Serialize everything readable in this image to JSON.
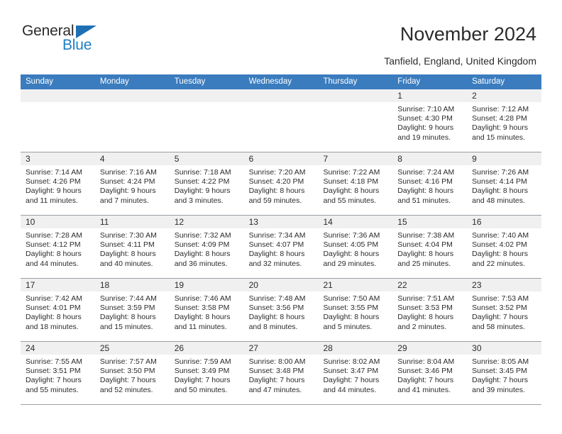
{
  "brand": {
    "name_part1": "General",
    "name_part2": "Blue",
    "triangle_color": "#1f6fb5",
    "blue_text_color": "#1f7fc4"
  },
  "header": {
    "title": "November 2024",
    "subtitle": "Tanfield, England, United Kingdom",
    "header_bg_color": "#3a7cbe",
    "day_band_color": "#f0f0f0"
  },
  "weekdays": [
    "Sunday",
    "Monday",
    "Tuesday",
    "Wednesday",
    "Thursday",
    "Friday",
    "Saturday"
  ],
  "weeks": [
    {
      "days": [
        {
          "date": "",
          "sunrise": "",
          "sunset": "",
          "daylight_line1": "",
          "daylight_line2": "",
          "empty": true
        },
        {
          "date": "",
          "sunrise": "",
          "sunset": "",
          "daylight_line1": "",
          "daylight_line2": "",
          "empty": true
        },
        {
          "date": "",
          "sunrise": "",
          "sunset": "",
          "daylight_line1": "",
          "daylight_line2": "",
          "empty": true
        },
        {
          "date": "",
          "sunrise": "",
          "sunset": "",
          "daylight_line1": "",
          "daylight_line2": "",
          "empty": true
        },
        {
          "date": "",
          "sunrise": "",
          "sunset": "",
          "daylight_line1": "",
          "daylight_line2": "",
          "empty": true
        },
        {
          "date": "1",
          "sunrise": "Sunrise: 7:10 AM",
          "sunset": "Sunset: 4:30 PM",
          "daylight_line1": "Daylight: 9 hours",
          "daylight_line2": "and 19 minutes.",
          "empty": false
        },
        {
          "date": "2",
          "sunrise": "Sunrise: 7:12 AM",
          "sunset": "Sunset: 4:28 PM",
          "daylight_line1": "Daylight: 9 hours",
          "daylight_line2": "and 15 minutes.",
          "empty": false
        }
      ]
    },
    {
      "days": [
        {
          "date": "3",
          "sunrise": "Sunrise: 7:14 AM",
          "sunset": "Sunset: 4:26 PM",
          "daylight_line1": "Daylight: 9 hours",
          "daylight_line2": "and 11 minutes.",
          "empty": false
        },
        {
          "date": "4",
          "sunrise": "Sunrise: 7:16 AM",
          "sunset": "Sunset: 4:24 PM",
          "daylight_line1": "Daylight: 9 hours",
          "daylight_line2": "and 7 minutes.",
          "empty": false
        },
        {
          "date": "5",
          "sunrise": "Sunrise: 7:18 AM",
          "sunset": "Sunset: 4:22 PM",
          "daylight_line1": "Daylight: 9 hours",
          "daylight_line2": "and 3 minutes.",
          "empty": false
        },
        {
          "date": "6",
          "sunrise": "Sunrise: 7:20 AM",
          "sunset": "Sunset: 4:20 PM",
          "daylight_line1": "Daylight: 8 hours",
          "daylight_line2": "and 59 minutes.",
          "empty": false
        },
        {
          "date": "7",
          "sunrise": "Sunrise: 7:22 AM",
          "sunset": "Sunset: 4:18 PM",
          "daylight_line1": "Daylight: 8 hours",
          "daylight_line2": "and 55 minutes.",
          "empty": false
        },
        {
          "date": "8",
          "sunrise": "Sunrise: 7:24 AM",
          "sunset": "Sunset: 4:16 PM",
          "daylight_line1": "Daylight: 8 hours",
          "daylight_line2": "and 51 minutes.",
          "empty": false
        },
        {
          "date": "9",
          "sunrise": "Sunrise: 7:26 AM",
          "sunset": "Sunset: 4:14 PM",
          "daylight_line1": "Daylight: 8 hours",
          "daylight_line2": "and 48 minutes.",
          "empty": false
        }
      ]
    },
    {
      "days": [
        {
          "date": "10",
          "sunrise": "Sunrise: 7:28 AM",
          "sunset": "Sunset: 4:12 PM",
          "daylight_line1": "Daylight: 8 hours",
          "daylight_line2": "and 44 minutes.",
          "empty": false
        },
        {
          "date": "11",
          "sunrise": "Sunrise: 7:30 AM",
          "sunset": "Sunset: 4:11 PM",
          "daylight_line1": "Daylight: 8 hours",
          "daylight_line2": "and 40 minutes.",
          "empty": false
        },
        {
          "date": "12",
          "sunrise": "Sunrise: 7:32 AM",
          "sunset": "Sunset: 4:09 PM",
          "daylight_line1": "Daylight: 8 hours",
          "daylight_line2": "and 36 minutes.",
          "empty": false
        },
        {
          "date": "13",
          "sunrise": "Sunrise: 7:34 AM",
          "sunset": "Sunset: 4:07 PM",
          "daylight_line1": "Daylight: 8 hours",
          "daylight_line2": "and 32 minutes.",
          "empty": false
        },
        {
          "date": "14",
          "sunrise": "Sunrise: 7:36 AM",
          "sunset": "Sunset: 4:05 PM",
          "daylight_line1": "Daylight: 8 hours",
          "daylight_line2": "and 29 minutes.",
          "empty": false
        },
        {
          "date": "15",
          "sunrise": "Sunrise: 7:38 AM",
          "sunset": "Sunset: 4:04 PM",
          "daylight_line1": "Daylight: 8 hours",
          "daylight_line2": "and 25 minutes.",
          "empty": false
        },
        {
          "date": "16",
          "sunrise": "Sunrise: 7:40 AM",
          "sunset": "Sunset: 4:02 PM",
          "daylight_line1": "Daylight: 8 hours",
          "daylight_line2": "and 22 minutes.",
          "empty": false
        }
      ]
    },
    {
      "days": [
        {
          "date": "17",
          "sunrise": "Sunrise: 7:42 AM",
          "sunset": "Sunset: 4:01 PM",
          "daylight_line1": "Daylight: 8 hours",
          "daylight_line2": "and 18 minutes.",
          "empty": false
        },
        {
          "date": "18",
          "sunrise": "Sunrise: 7:44 AM",
          "sunset": "Sunset: 3:59 PM",
          "daylight_line1": "Daylight: 8 hours",
          "daylight_line2": "and 15 minutes.",
          "empty": false
        },
        {
          "date": "19",
          "sunrise": "Sunrise: 7:46 AM",
          "sunset": "Sunset: 3:58 PM",
          "daylight_line1": "Daylight: 8 hours",
          "daylight_line2": "and 11 minutes.",
          "empty": false
        },
        {
          "date": "20",
          "sunrise": "Sunrise: 7:48 AM",
          "sunset": "Sunset: 3:56 PM",
          "daylight_line1": "Daylight: 8 hours",
          "daylight_line2": "and 8 minutes.",
          "empty": false
        },
        {
          "date": "21",
          "sunrise": "Sunrise: 7:50 AM",
          "sunset": "Sunset: 3:55 PM",
          "daylight_line1": "Daylight: 8 hours",
          "daylight_line2": "and 5 minutes.",
          "empty": false
        },
        {
          "date": "22",
          "sunrise": "Sunrise: 7:51 AM",
          "sunset": "Sunset: 3:53 PM",
          "daylight_line1": "Daylight: 8 hours",
          "daylight_line2": "and 2 minutes.",
          "empty": false
        },
        {
          "date": "23",
          "sunrise": "Sunrise: 7:53 AM",
          "sunset": "Sunset: 3:52 PM",
          "daylight_line1": "Daylight: 7 hours",
          "daylight_line2": "and 58 minutes.",
          "empty": false
        }
      ]
    },
    {
      "days": [
        {
          "date": "24",
          "sunrise": "Sunrise: 7:55 AM",
          "sunset": "Sunset: 3:51 PM",
          "daylight_line1": "Daylight: 7 hours",
          "daylight_line2": "and 55 minutes.",
          "empty": false
        },
        {
          "date": "25",
          "sunrise": "Sunrise: 7:57 AM",
          "sunset": "Sunset: 3:50 PM",
          "daylight_line1": "Daylight: 7 hours",
          "daylight_line2": "and 52 minutes.",
          "empty": false
        },
        {
          "date": "26",
          "sunrise": "Sunrise: 7:59 AM",
          "sunset": "Sunset: 3:49 PM",
          "daylight_line1": "Daylight: 7 hours",
          "daylight_line2": "and 50 minutes.",
          "empty": false
        },
        {
          "date": "27",
          "sunrise": "Sunrise: 8:00 AM",
          "sunset": "Sunset: 3:48 PM",
          "daylight_line1": "Daylight: 7 hours",
          "daylight_line2": "and 47 minutes.",
          "empty": false
        },
        {
          "date": "28",
          "sunrise": "Sunrise: 8:02 AM",
          "sunset": "Sunset: 3:47 PM",
          "daylight_line1": "Daylight: 7 hours",
          "daylight_line2": "and 44 minutes.",
          "empty": false
        },
        {
          "date": "29",
          "sunrise": "Sunrise: 8:04 AM",
          "sunset": "Sunset: 3:46 PM",
          "daylight_line1": "Daylight: 7 hours",
          "daylight_line2": "and 41 minutes.",
          "empty": false
        },
        {
          "date": "30",
          "sunrise": "Sunrise: 8:05 AM",
          "sunset": "Sunset: 3:45 PM",
          "daylight_line1": "Daylight: 7 hours",
          "daylight_line2": "and 39 minutes.",
          "empty": false
        }
      ]
    }
  ]
}
